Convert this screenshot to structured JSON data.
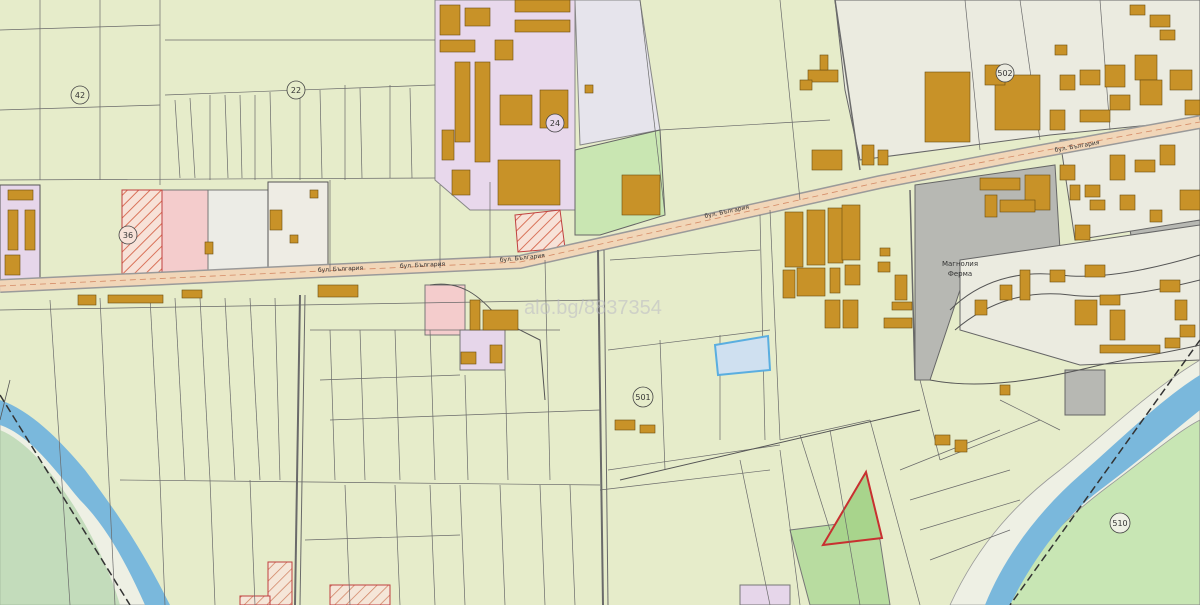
{
  "map": {
    "watermark": "alo.bg/8837354",
    "parcel_numbers": [
      "42",
      "22",
      "24",
      "36",
      "501",
      "510",
      "502"
    ],
    "street_labels": [
      "бул. България",
      "бул. България",
      "бул. България",
      "бул. България",
      "бул. България"
    ],
    "area_labels": [
      "Магнолия",
      "Ферма"
    ],
    "highlighted_parcel": {
      "color": "#cfe0f0",
      "border": "#5aaee0"
    },
    "colors": {
      "background": "#e6ecca",
      "building": "#c89228",
      "road": "#f1d6b8",
      "industrial": "#e8d8ec",
      "hatched": "#f4c8c0",
      "green_zone": "#b8dca0",
      "river": "#7ab8dc",
      "riverbank": "#eef0e4",
      "gray_zone": "#b7b8b3"
    }
  }
}
